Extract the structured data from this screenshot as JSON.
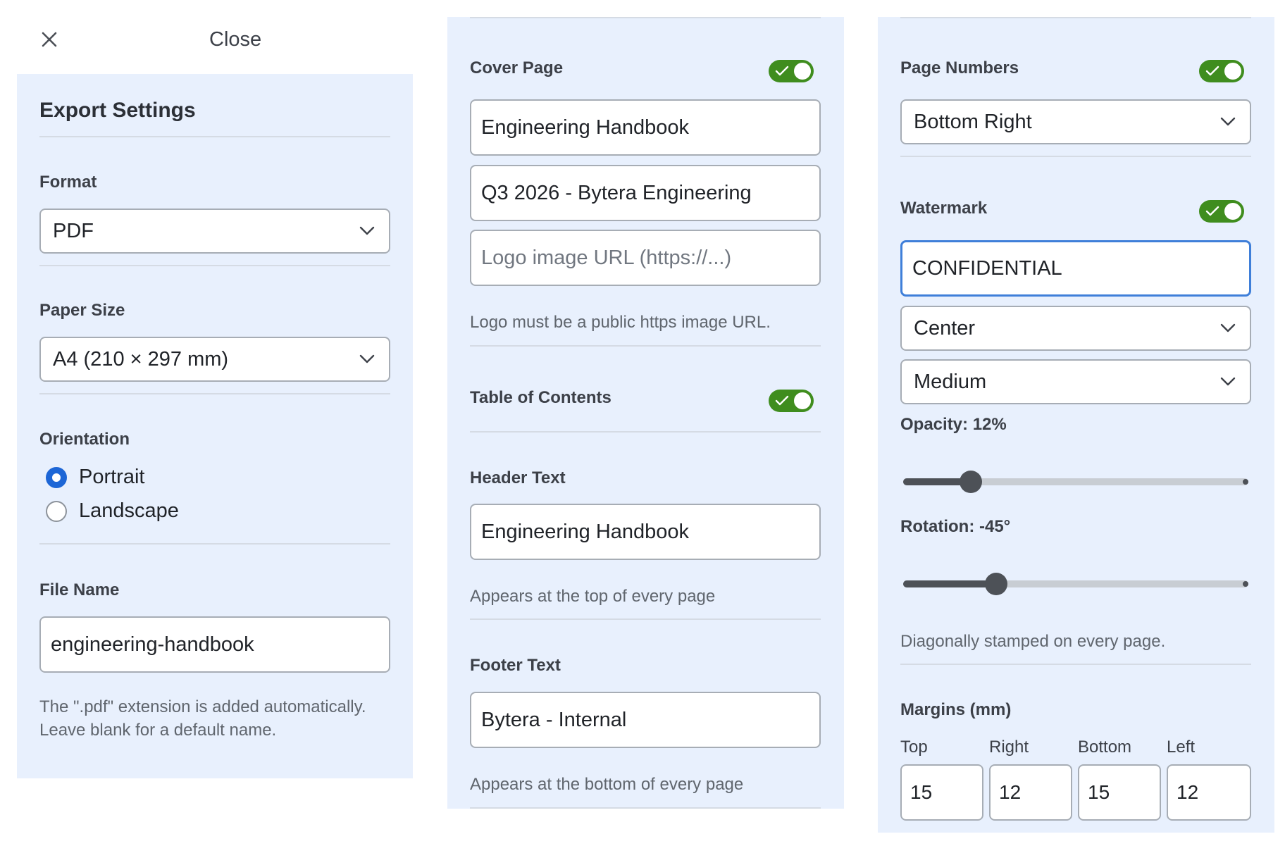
{
  "close": {
    "label": "Close"
  },
  "export": {
    "heading": "Export Settings",
    "format": {
      "label": "Format",
      "value": "PDF"
    },
    "paper_size": {
      "label": "Paper Size",
      "value": "A4 (210 × 297 mm)"
    },
    "orientation": {
      "label": "Orientation",
      "options": [
        {
          "label": "Portrait",
          "selected": true
        },
        {
          "label": "Landscape",
          "selected": false
        }
      ]
    },
    "file_name": {
      "label": "File Name",
      "value": "engineering-handbook",
      "help": "The \".pdf\" extension is added automatically. Leave blank for a default name."
    }
  },
  "cover_page": {
    "label": "Cover Page",
    "enabled": true,
    "title_value": "Engineering Handbook",
    "subtitle_value": "Q3 2026 - Bytera Engineering",
    "logo_placeholder": "Logo image URL (https://...)",
    "logo_help": "Logo must be a public https image URL."
  },
  "toc": {
    "label": "Table of Contents",
    "enabled": true
  },
  "header_text": {
    "label": "Header Text",
    "value": "Engineering Handbook",
    "help": "Appears at the top of every page"
  },
  "footer_text": {
    "label": "Footer Text",
    "value": "Bytera - Internal",
    "help": "Appears at the bottom of every page"
  },
  "page_numbers": {
    "label": "Page Numbers",
    "enabled": true,
    "position": "Bottom Right"
  },
  "watermark": {
    "label": "Watermark",
    "enabled": true,
    "text": "CONFIDENTIAL",
    "position": "Center",
    "size": "Medium",
    "opacity_label": "Opacity: 12%",
    "opacity_value": 12,
    "rotation_label": "Rotation: -45°",
    "rotation_value": -45,
    "help": "Diagonally stamped on every page."
  },
  "margins": {
    "label": "Margins (mm)",
    "items": [
      {
        "label": "Top",
        "value": "15"
      },
      {
        "label": "Right",
        "value": "12"
      },
      {
        "label": "Bottom",
        "value": "15"
      },
      {
        "label": "Left",
        "value": "12"
      }
    ]
  },
  "colors": {
    "panel_bg": "#e8f0fd",
    "toggle_on": "#3f8d1e",
    "radio_on": "#1d66d6",
    "focus": "#3f7fd9"
  }
}
